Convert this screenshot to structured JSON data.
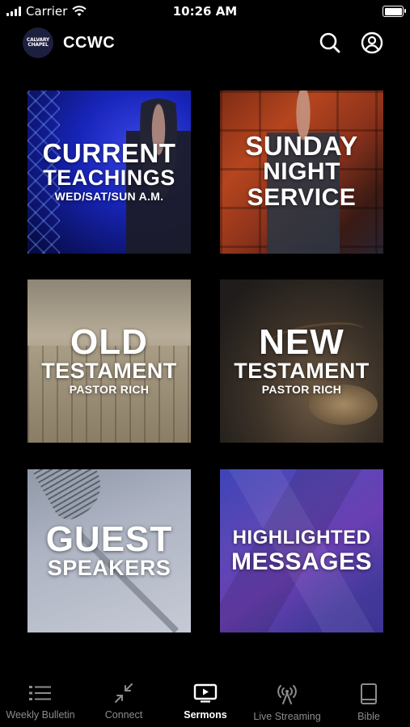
{
  "status_bar": {
    "carrier": "Carrier",
    "time": "10:26 AM",
    "battery_level": 1.0
  },
  "header": {
    "logo_text": "CALVARY CHAPEL",
    "title": "CCWC",
    "search_icon": "search-icon",
    "account_icon": "account-icon"
  },
  "tiles": [
    {
      "line1": "CURRENT",
      "line2": "TEACHINGS",
      "line3": "WED/SAT/SUN A.M."
    },
    {
      "line1": "SUNDAY",
      "line2": "NIGHT",
      "line3": "SERVICE"
    },
    {
      "line1": "OLD",
      "line2": "TESTAMENT",
      "line3": "PASTOR RICH"
    },
    {
      "line1": "NEW",
      "line2": "TESTAMENT",
      "line3": "PASTOR RICH"
    },
    {
      "line1": "GUEST",
      "line2": "SPEAKERS"
    },
    {
      "line1": "HIGHLIGHTED",
      "line2": "MESSAGES"
    }
  ],
  "tab_bar": {
    "active": "Sermons",
    "items": [
      {
        "label": "Weekly Bulletin",
        "icon": "list-icon"
      },
      {
        "label": "Connect",
        "icon": "arrows-in-icon"
      },
      {
        "label": "Sermons",
        "icon": "video-icon"
      },
      {
        "label": "Live Streaming",
        "icon": "broadcast-icon"
      },
      {
        "label": "Bible",
        "icon": "book-icon"
      }
    ]
  }
}
